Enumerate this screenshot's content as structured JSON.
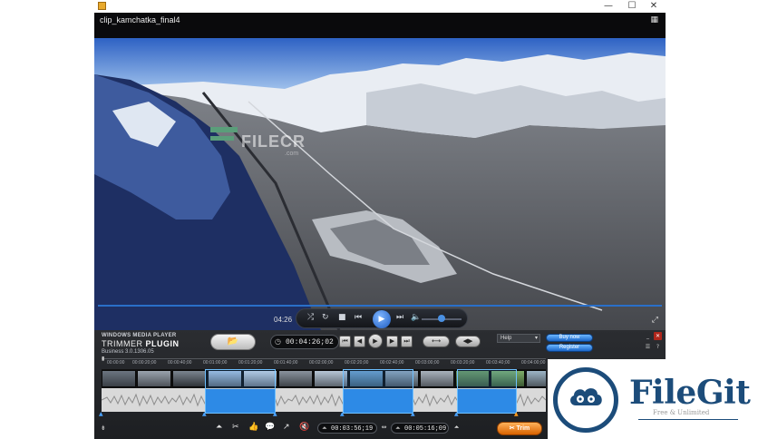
{
  "window": {
    "controls": {
      "minimize": "—",
      "maximize": "☐",
      "close": "✕"
    }
  },
  "player": {
    "clip_title": "clip_kamchatka_final4",
    "elapsed": "04:26",
    "watermark": "FILECR",
    "watermark_sub": ".com",
    "icons": {
      "shuffle": "⤮",
      "repeat": "↻",
      "stop": "■",
      "prev": "⏮",
      "play": "▶",
      "next": "⏭",
      "volume": "🔈",
      "corner": "▦",
      "fullscreen": "⤢"
    }
  },
  "plugin": {
    "brand_small": "WINDOWS MEDIA PLAYER",
    "brand_title_prefix": "TRIMMER",
    "brand_title_bold": "PLUGIN",
    "version": "Business 3.0.1306.05",
    "current_time": "00:04:26;02",
    "help_label": "Help",
    "buy_now": "Buy now",
    "register": "Register",
    "ruler_labels": [
      "00:00:00",
      "00:00:20;00",
      "00:00:40;00",
      "00:01:00;00",
      "00:01:20;00",
      "00:01:40;00",
      "00:02:00;00",
      "00:02:20;00",
      "00:02:40;00",
      "00:03:00;00",
      "00:03:20;00",
      "00:03:40;00",
      "00:04:00;00"
    ],
    "selection_start": "00:03:56;19",
    "selection_end": "00:05:16;09",
    "trim_label": "Trim",
    "icons": {
      "open": "📂",
      "clock": "◷",
      "skip_start": "⏮",
      "step_back": "◀",
      "play": "▶",
      "step_fwd": "▶",
      "skip_end": "⏭",
      "loop": "⟷",
      "speed": "◀▶",
      "expand": "⇟",
      "tool1": "⏶",
      "tool2": "✂",
      "tool3": "👍",
      "tool4": "💬",
      "tool5": "↗",
      "tool6": "🔇",
      "sel_start": "⏶",
      "sel_end": "⏶",
      "swap": "⇔"
    }
  },
  "badge": {
    "name": "FileGit",
    "tagline": "Free & Unlimited"
  }
}
